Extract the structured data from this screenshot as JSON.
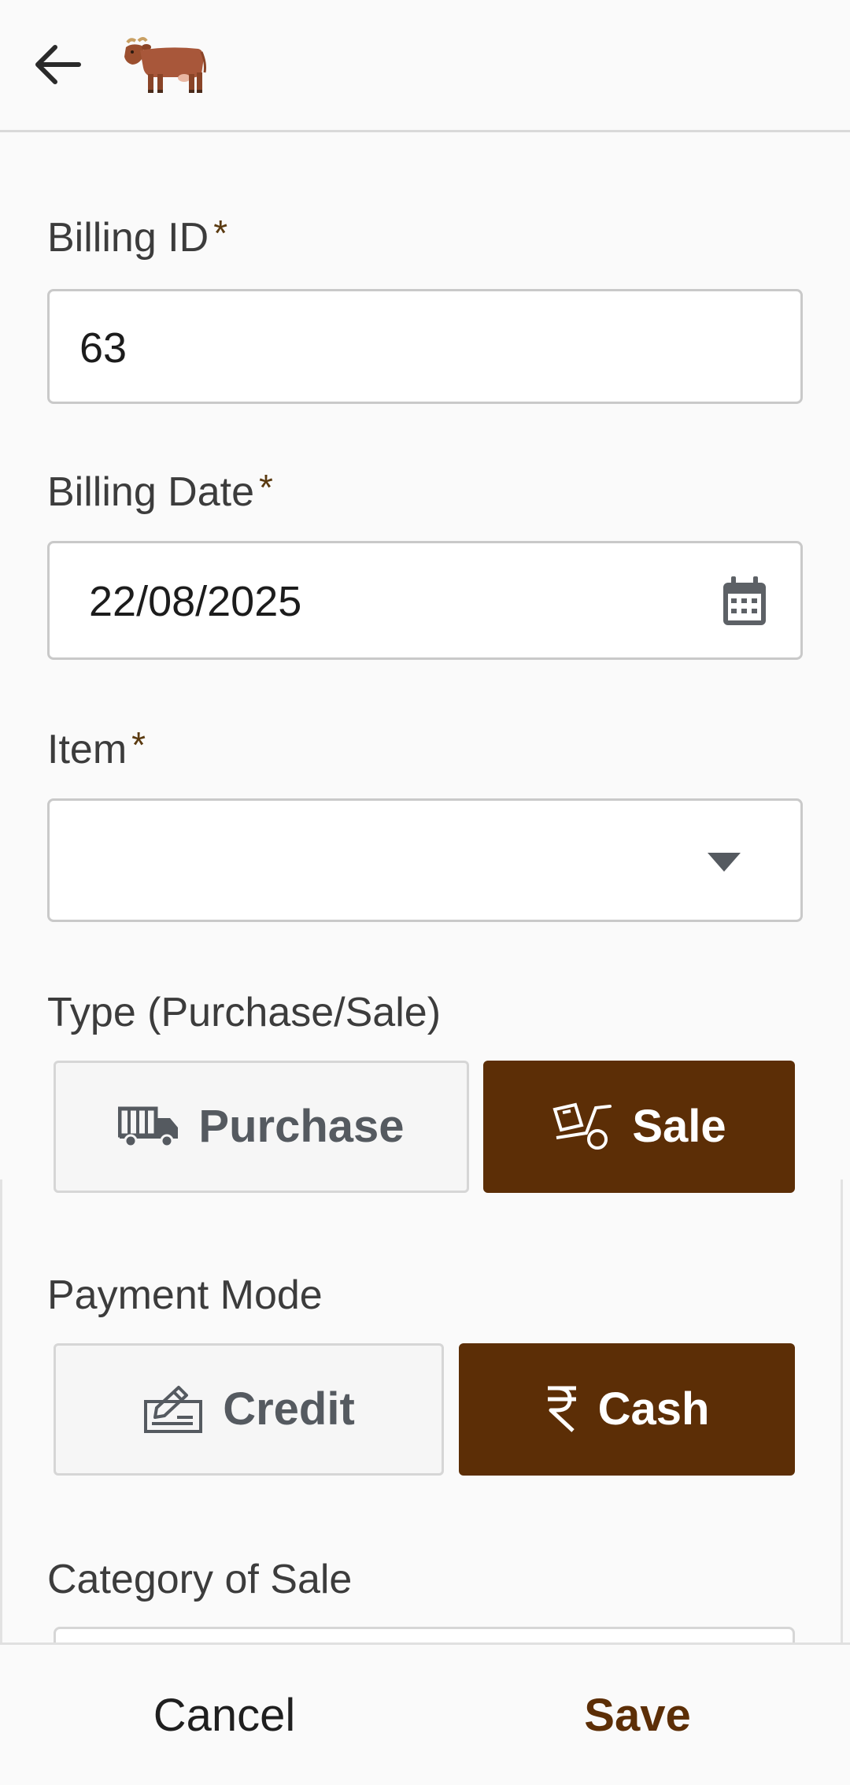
{
  "header": {
    "back_icon": "arrow-left-icon",
    "logo_icon": "cow-icon"
  },
  "form": {
    "billing_id": {
      "label": "Billing ID",
      "required_mark": "*",
      "value": "63"
    },
    "billing_date": {
      "label": "Billing Date",
      "required_mark": "*",
      "value": "22/08/2025",
      "icon": "calendar-icon"
    },
    "item": {
      "label": "Item",
      "required_mark": "*",
      "value": "",
      "icon": "dropdown-caret-icon"
    },
    "type": {
      "label": "Type (Purchase/Sale)",
      "options": [
        {
          "label": "Purchase",
          "icon": "truck-icon",
          "selected": false
        },
        {
          "label": "Sale",
          "icon": "hand-truck-icon",
          "selected": true
        }
      ]
    },
    "payment_mode": {
      "label": "Payment Mode",
      "options": [
        {
          "label": "Credit",
          "icon": "signature-icon",
          "selected": false
        },
        {
          "label": "Cash",
          "icon": "rupee-icon",
          "selected": true
        }
      ]
    },
    "category_of_sale": {
      "label": "Category of Sale"
    }
  },
  "footer": {
    "cancel_label": "Cancel",
    "save_label": "Save"
  },
  "colors": {
    "accent": "#5c2e06",
    "required_mark": "#5a3a10",
    "background": "#fafafa"
  }
}
